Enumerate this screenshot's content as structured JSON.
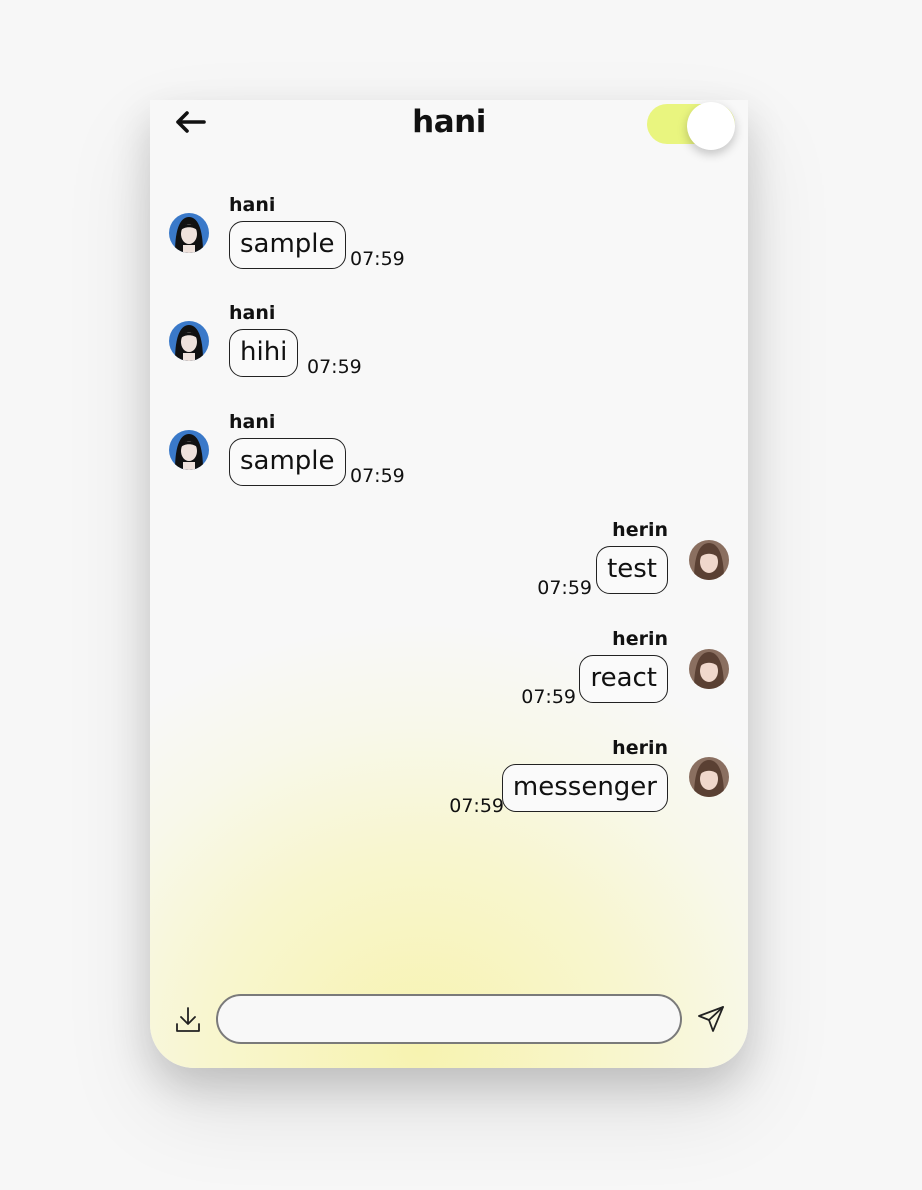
{
  "header": {
    "title": "hani",
    "toggle_on": true
  },
  "colors": {
    "accent": "#e9f57f",
    "bubble_border": "#222222",
    "background_glow": "#f7f3b0"
  },
  "messages": [
    {
      "sender": "hani",
      "text": "sample",
      "time": "07:59",
      "side": "left",
      "avatar": "avatar-hani"
    },
    {
      "sender": "hani",
      "text": "hihi",
      "time": "07:59",
      "side": "left",
      "avatar": "avatar-hani"
    },
    {
      "sender": "hani",
      "text": "sample",
      "time": "07:59",
      "side": "left",
      "avatar": "avatar-hani"
    },
    {
      "sender": "herin",
      "text": "test",
      "time": "07:59",
      "side": "right",
      "avatar": "avatar-herin"
    },
    {
      "sender": "herin",
      "text": "react",
      "time": "07:59",
      "side": "right",
      "avatar": "avatar-herin"
    },
    {
      "sender": "herin",
      "text": "messenger",
      "time": "07:59",
      "side": "right",
      "avatar": "avatar-herin"
    }
  ],
  "composer": {
    "value": "",
    "placeholder": ""
  },
  "icons": {
    "back": "back-arrow-icon",
    "download": "download-icon",
    "send": "send-icon"
  }
}
